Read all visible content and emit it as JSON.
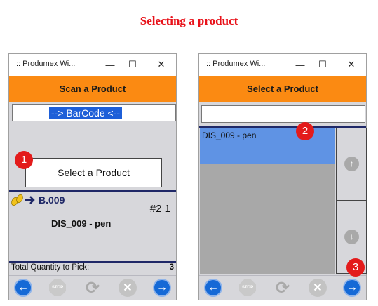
{
  "page_title": "Selecting a product",
  "colors": {
    "title_red": "#e8121a",
    "header_orange": "#fb8a12",
    "navy": "#1f2867",
    "selection_blue": "#5f93e4",
    "badge_red": "#e31b1b"
  },
  "left_window": {
    "title": ":: Produmex Wi...",
    "header": "Scan a Product",
    "barcode_value": "--> BarCode <--",
    "select_button": "Select a Product",
    "badge": "1",
    "location": "B.009",
    "sequence": "#2 1",
    "product": "DIS_009 - pen",
    "total_label": "Total Quantity to Pick:",
    "total_value": "3"
  },
  "right_window": {
    "title": ":: Produmex Wi...",
    "header": "Select a Product",
    "search_value": "",
    "list_items": [
      "DIS_009 - pen"
    ],
    "badge_list": "2",
    "badge_next": "3"
  },
  "titlebar_controls": {
    "minimize": "—",
    "maximize": "☐",
    "close": "✕"
  },
  "toolbar_icons": [
    "back-arrow-icon",
    "stop-icon",
    "refresh-icon",
    "cancel-icon",
    "next-arrow-icon"
  ]
}
